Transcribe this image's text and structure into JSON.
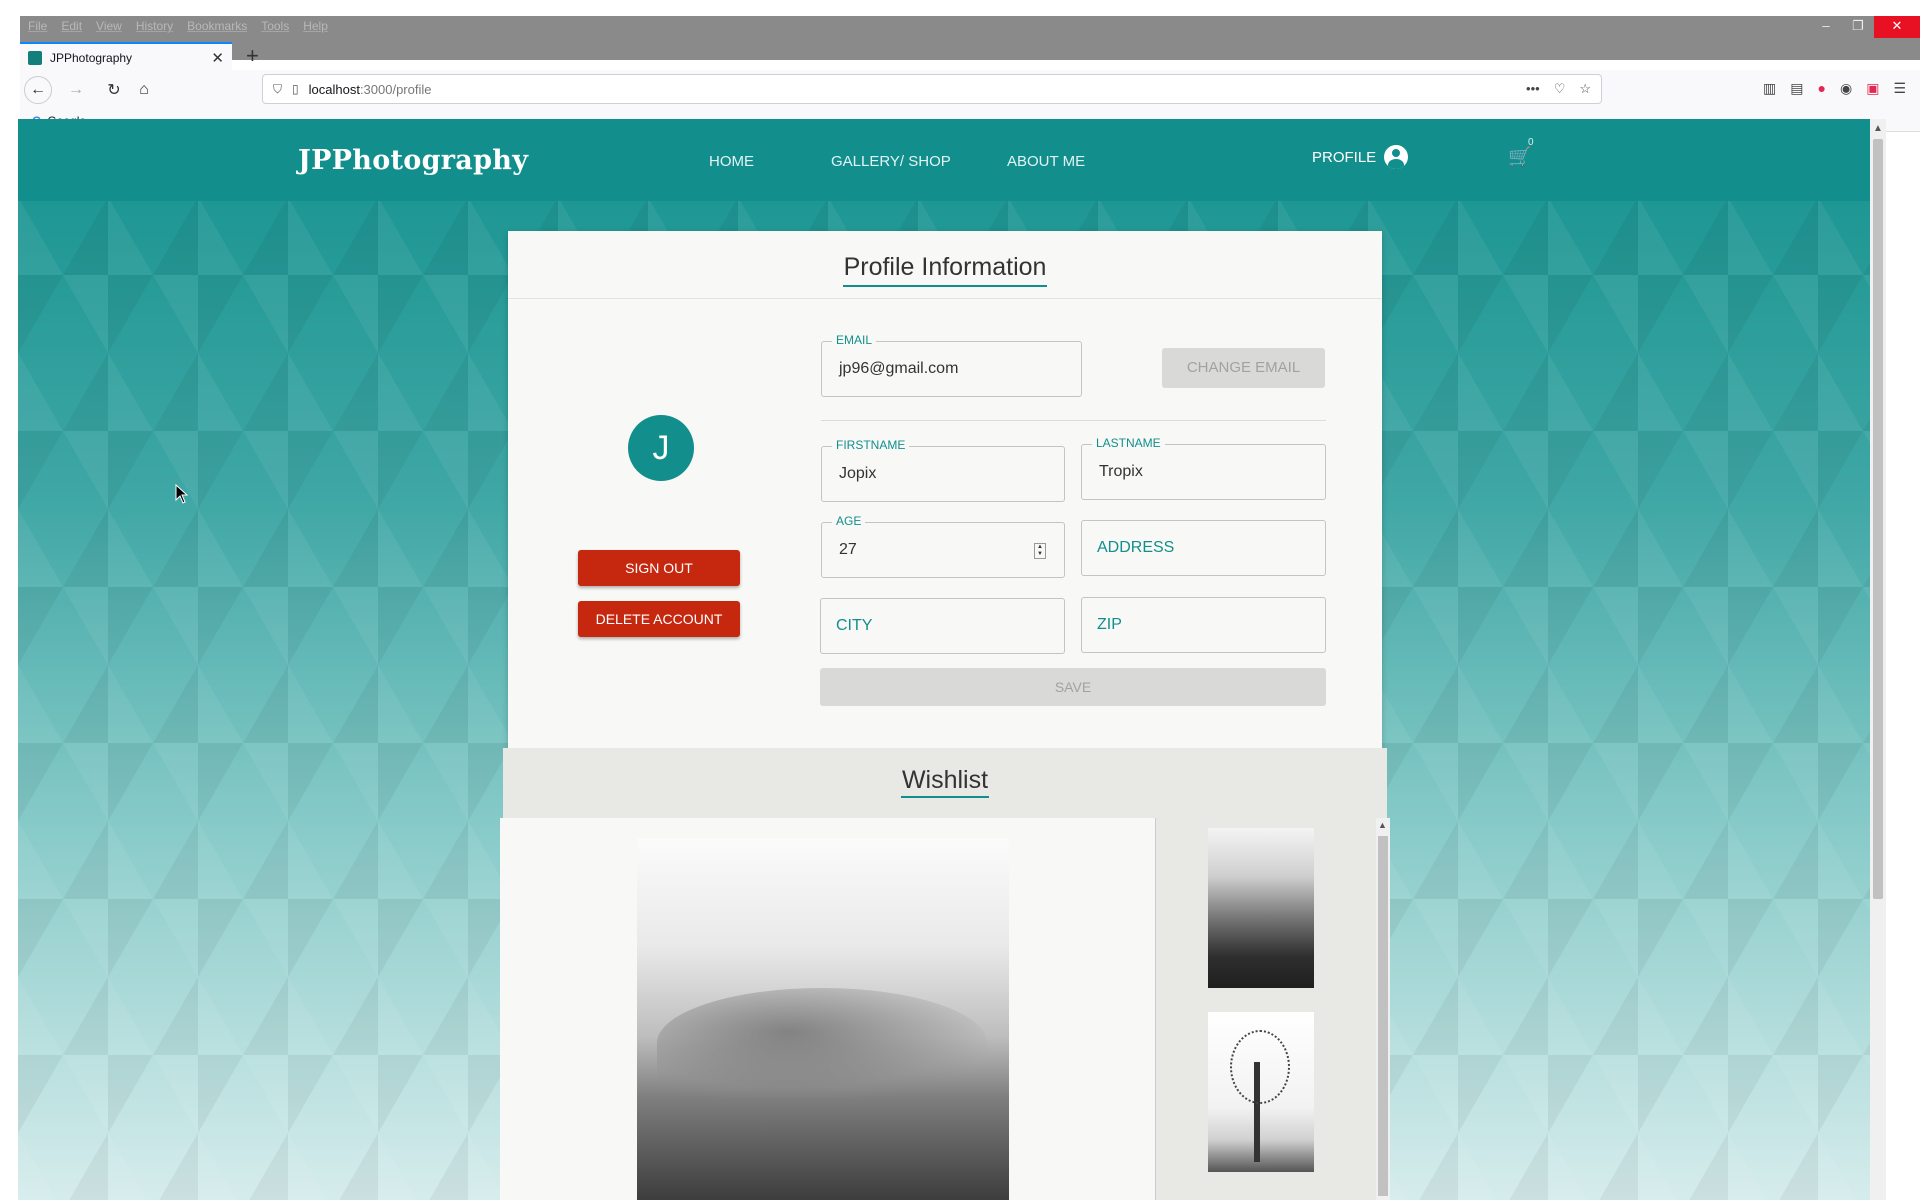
{
  "browser": {
    "menu": [
      "File",
      "Edit",
      "View",
      "History",
      "Bookmarks",
      "Tools",
      "Help"
    ],
    "tab_title": "JPPhotography",
    "url_host": "localhost",
    "url_path": ":3000/profile",
    "bookmark": "Google"
  },
  "site": {
    "brand": "JPPhotography",
    "nav": [
      "HOME",
      "GALLERY/ SHOP",
      "ABOUT ME"
    ],
    "profile_label": "PROFILE",
    "cart_count": "0"
  },
  "profile": {
    "title": "Profile Information",
    "avatar_letter": "J",
    "sign_out": "SIGN OUT",
    "delete_account": "DELETE ACCOUNT",
    "email": {
      "label": "EMAIL",
      "value": "jp96@gmail.com"
    },
    "change_email": "CHANGE EMAIL",
    "firstname": {
      "label": "FIRSTNAME",
      "value": "Jopix"
    },
    "lastname": {
      "label": "LASTNAME",
      "value": "Tropix"
    },
    "age": {
      "label": "AGE",
      "value": "27"
    },
    "address_placeholder": "ADDRESS",
    "city_placeholder": "CITY",
    "zip_placeholder": "ZIP",
    "save": "SAVE"
  },
  "wishlist": {
    "title": "Wishlist"
  }
}
